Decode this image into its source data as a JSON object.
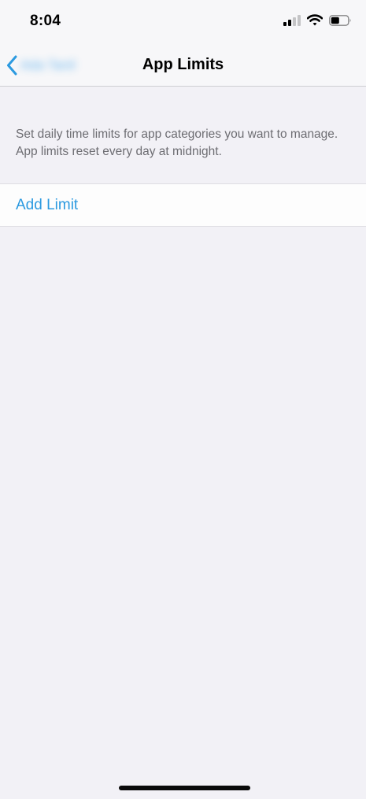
{
  "status_bar": {
    "time": "8:04",
    "signal_icon": "cellular-signal-icon",
    "wifi_icon": "wifi-icon",
    "battery_icon": "battery-icon",
    "battery_level": 0.5
  },
  "nav": {
    "back_icon": "chevron-left-icon",
    "back_label": "Ada Tanil",
    "title": "App Limits"
  },
  "description": "Set daily time limits for app categories you want to manage. App limits reset every day at midnight.",
  "add_limit_label": "Add Limit",
  "colors": {
    "accent": "#2c9ae0",
    "background": "#f2f1f6",
    "secondary_text": "#6d6d72"
  }
}
